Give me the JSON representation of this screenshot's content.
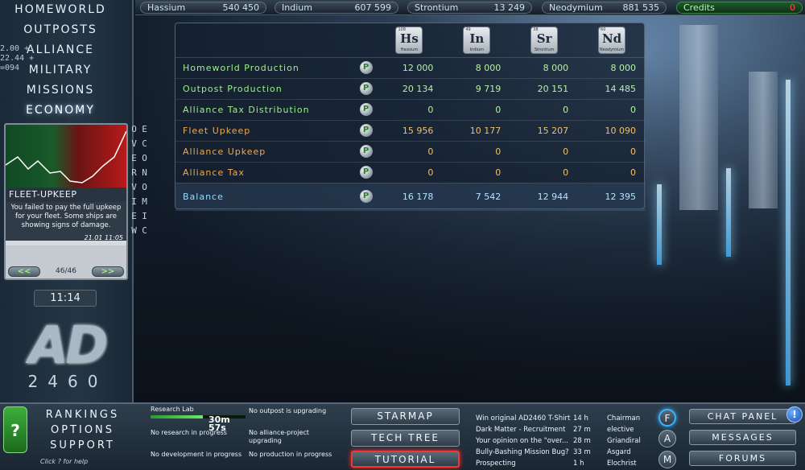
{
  "resources": [
    {
      "name": "Hassium",
      "value": "540 450"
    },
    {
      "name": "Indium",
      "value": "607 599"
    },
    {
      "name": "Strontium",
      "value": "13 249"
    },
    {
      "name": "Neodymium",
      "value": "881 535"
    },
    {
      "name": "Credits",
      "value": "0"
    }
  ],
  "nav": [
    "HOMEWORLD",
    "OUTPOSTS",
    "ALLIANCE",
    "MILITARY",
    "MISSIONS",
    "ECONOMY"
  ],
  "coords_overlay": [
    "2.00 +",
    "22.44 +",
    "=094"
  ],
  "event": {
    "title": "FLEET-UPKEEP",
    "text": "You failed to pay the full upkeep for your fleet. Some ships are showing signs of damage.",
    "date": "21.01 11:05",
    "page": "46/46",
    "prev": "<<",
    "next": ">>"
  },
  "clock": "11:14",
  "logo": {
    "letters": "AD",
    "number": "2460"
  },
  "economy": {
    "vertical_title": "ECONOMIC OVERVIEW",
    "info_glyph": "P",
    "elements": [
      {
        "z": "108",
        "symbol": "Hs",
        "name": "Hassium"
      },
      {
        "z": "49",
        "symbol": "In",
        "name": "Indium"
      },
      {
        "z": "38",
        "symbol": "Sr",
        "name": "Strontium"
      },
      {
        "z": "60",
        "symbol": "Nd",
        "name": "Neodymium"
      }
    ],
    "rows": [
      {
        "label": "Homeworld Production",
        "kind": "prod",
        "values": [
          "12 000",
          "8 000",
          "8 000",
          "8 000"
        ]
      },
      {
        "label": "Outpost Production",
        "kind": "prod",
        "values": [
          "20 134",
          "9 719",
          "20 151",
          "14 485"
        ]
      },
      {
        "label": "Alliance Tax Distribution",
        "kind": "prod",
        "values": [
          "0",
          "0",
          "0",
          "0"
        ]
      },
      {
        "label": "Fleet Upkeep",
        "kind": "up",
        "values": [
          "15 956",
          "10 177",
          "15 207",
          "10 090"
        ]
      },
      {
        "label": "Alliance Upkeep",
        "kind": "up",
        "values": [
          "0",
          "0",
          "0",
          "0"
        ]
      },
      {
        "label": "Alliance Tax",
        "kind": "up",
        "values": [
          "0",
          "0",
          "0",
          "0"
        ]
      },
      {
        "label": "Balance",
        "kind": "bal",
        "values": [
          "16 178",
          "7 542",
          "12 944",
          "12 395"
        ]
      }
    ]
  },
  "bottom": {
    "help_glyph": "?",
    "help_text": "Click ? for help",
    "menu": [
      "RANKINGS",
      "OPTIONS",
      "SUPPORT"
    ],
    "status": {
      "research_lab": "Research Lab",
      "research_timer": "30m 57s",
      "research_progress": 0.55,
      "outpost": "No outpost is upgrading",
      "research": "No research in progress",
      "alliance_project": "No alliance-project upgrading",
      "development": "No development in progress",
      "production": "No production in progress"
    },
    "nav_buttons": [
      "STARMAP",
      "TECH TREE",
      "TUTORIAL"
    ],
    "news": [
      {
        "title": "Win original AD2460 T-Shirt",
        "age": "14 h",
        "user": "Chairman"
      },
      {
        "title": "Dark Matter - Recruitment",
        "age": "27 m",
        "user": "elective"
      },
      {
        "title": "Your opinion on the \"over...",
        "age": "28 m",
        "user": "Griandiral"
      },
      {
        "title": "Bully-Bashing Mission Bug?",
        "age": "33 m",
        "user": "Asgard"
      },
      {
        "title": "Prospecting",
        "age": "1 h",
        "user": "Elochrist"
      }
    ],
    "round_buttons": [
      "F",
      "A",
      "M"
    ],
    "right_buttons": [
      "CHAT PANEL",
      "MESSAGES",
      "FORUMS"
    ],
    "alert_glyph": "!"
  }
}
